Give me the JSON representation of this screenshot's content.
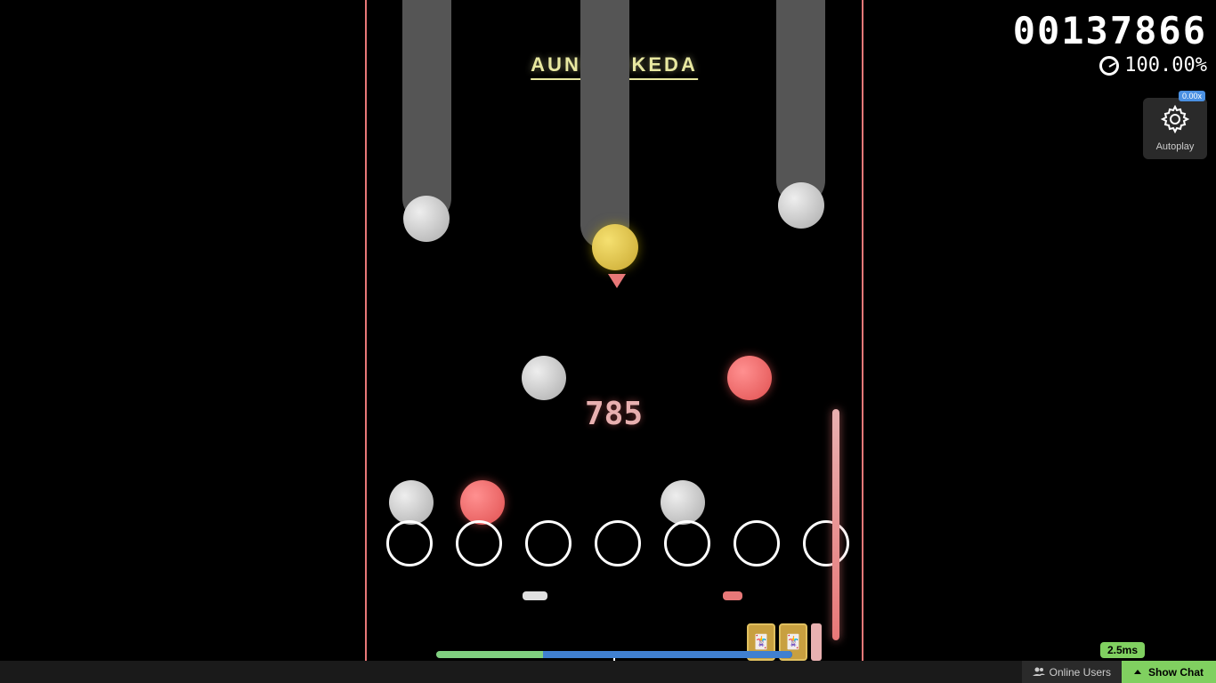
{
  "score": {
    "number": "00137866",
    "accuracy": "100.00%",
    "badge": "0.00x"
  },
  "title": "AUNRANKEDA",
  "combo": "785",
  "settings": {
    "autoplay_label": "Autoplay"
  },
  "bottom_bar": {
    "latency": "2.5ms",
    "online_users": "Online Users",
    "show_chat": "Show Chat"
  },
  "progress": {
    "green_pct": 30,
    "blue_pct": 70
  }
}
